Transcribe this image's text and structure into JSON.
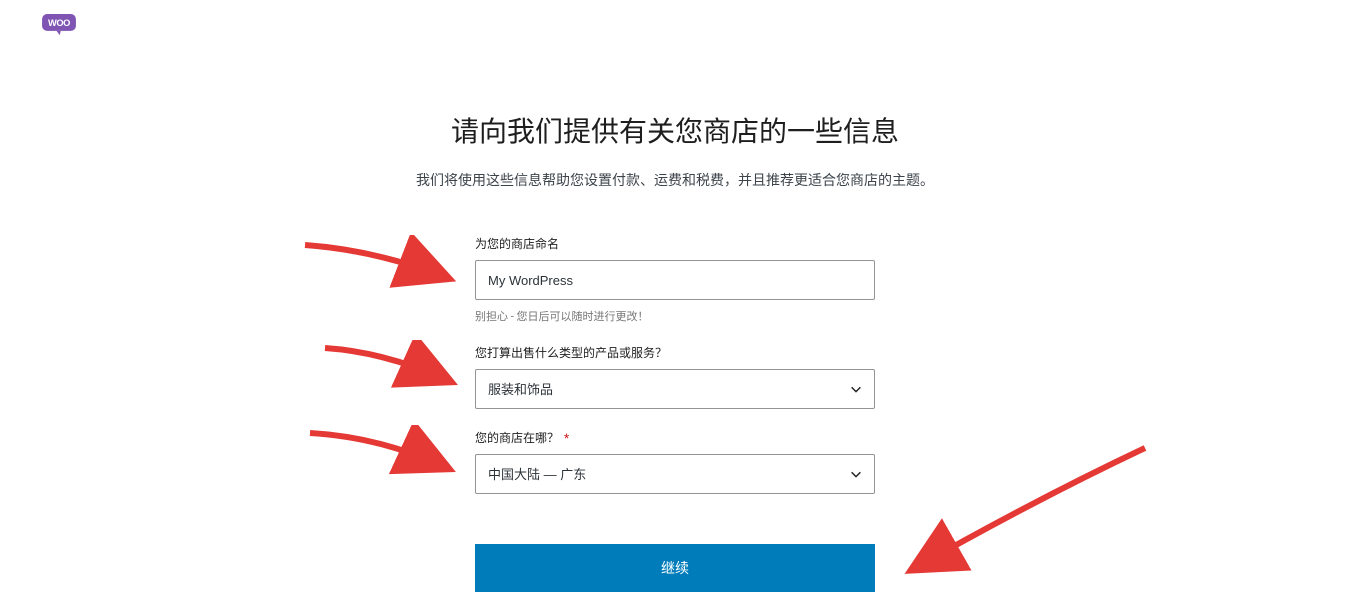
{
  "logo": {
    "name": "woo"
  },
  "heading": "请向我们提供有关您商店的一些信息",
  "subtitle": "我们将使用这些信息帮助您设置付款、运费和税费，并且推荐更适合您商店的主题。",
  "form": {
    "store_name": {
      "label": "为您的商店命名",
      "value": "My WordPress",
      "helper": "别担心 - 您日后可以随时进行更改！"
    },
    "product_type": {
      "label": "您打算出售什么类型的产品或服务？",
      "selected": "服装和饰品"
    },
    "location": {
      "label": "您的商店在哪？",
      "required_marker": "*",
      "selected": "中国大陆 — 广东"
    },
    "submit_label": "继续"
  },
  "annotations": {
    "arrows": [
      {
        "target": "store-name-input"
      },
      {
        "target": "product-type-select"
      },
      {
        "target": "location-select"
      },
      {
        "target": "continue-button"
      }
    ]
  }
}
